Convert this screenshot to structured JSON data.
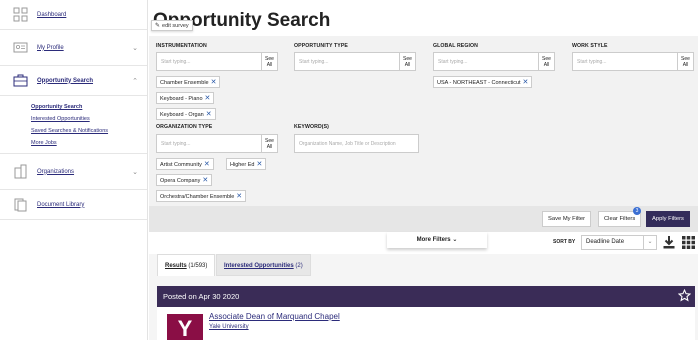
{
  "sidebar": {
    "items": [
      {
        "label": "Dashboard"
      },
      {
        "label": "My Profile"
      },
      {
        "label": "Opportunity Search"
      },
      {
        "label": "Organizations"
      },
      {
        "label": "Document Library"
      }
    ],
    "subitems": [
      {
        "label": "Opportunity Search"
      },
      {
        "label": "Interested Opportunities"
      },
      {
        "label": "Saved Searches & Notifications"
      },
      {
        "label": "More Jobs"
      }
    ]
  },
  "header": {
    "title": "Opportunity Search",
    "survey_label": "edit survey"
  },
  "filters": {
    "instrumentation": {
      "label": "INSTRUMENTATION",
      "placeholder": "Start typing...",
      "see_all": "See All",
      "chips": [
        "Chamber Ensemble",
        "Keyboard - Piano",
        "Keyboard - Organ"
      ]
    },
    "opportunity_type": {
      "label": "OPPORTUNITY TYPE",
      "placeholder": "Start typing...",
      "see_all": "See All"
    },
    "global_region": {
      "label": "GLOBAL REGION",
      "placeholder": "Start typing...",
      "see_all": "See All",
      "chips": [
        "USA - NORTHEAST - Connecticut"
      ]
    },
    "work_style": {
      "label": "WORK STYLE",
      "placeholder": "Start typing...",
      "see_all": "See All"
    },
    "organization_type": {
      "label": "ORGANIZATION TYPE",
      "placeholder": "Start typing...",
      "see_all": "See All",
      "chips": [
        "Artist Community",
        "Higher Ed",
        "Opera Company",
        "Orchestra/Chamber Ensemble"
      ]
    },
    "keywords": {
      "label": "KEYWORD(S)",
      "placeholder": "Organization Name, Job Title or Description"
    }
  },
  "actions": {
    "save_filter": "Save My Filter",
    "clear_filters": "Clear Filters",
    "apply_filters": "Apply Filters",
    "badge": "3"
  },
  "sort": {
    "more_filters": "More Filters",
    "label": "SORT BY",
    "value": "Deadline Date"
  },
  "results": {
    "tab_results": "Results",
    "tab_results_count": "(1/593)",
    "tab_interested": "Interested Opportunities",
    "tab_interested_count": "(2)",
    "posted": "Posted on Apr 30 2020",
    "job_title": "Associate Dean of Marquand Chapel",
    "job_org": "Yale University",
    "logo_letter": "Y"
  },
  "colors": {
    "accent": "#332c5a",
    "posted_bar": "#3a2c57",
    "logo": "#8a0e45",
    "link": "#2b2b7a"
  }
}
